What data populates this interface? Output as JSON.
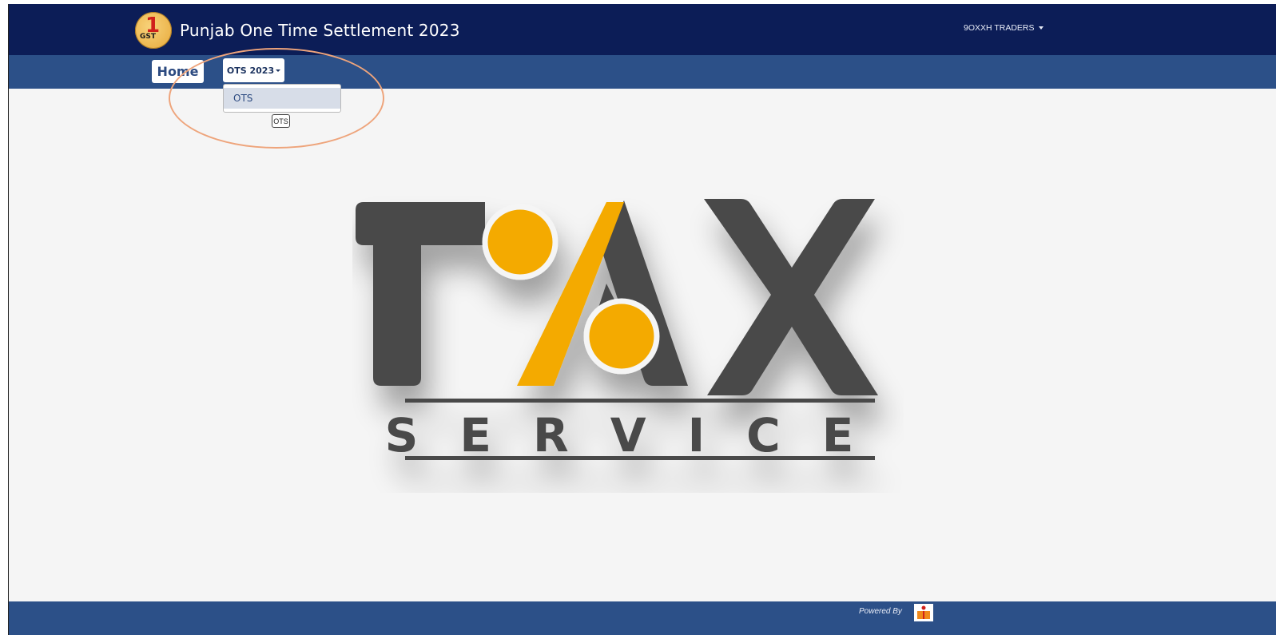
{
  "header": {
    "title": "Punjab One Time Settlement 2023",
    "logo_text_number": "1",
    "logo_text_sub": "GST",
    "user_name": "9OXXH TRADERS"
  },
  "nav": {
    "home_label": "Home",
    "ots_menu_label": "OTS 2023",
    "dropdown_items": [
      {
        "label": "OTS"
      }
    ],
    "ots_tag_label": "OTS"
  },
  "hero": {
    "word_top": "TAX",
    "word_bottom": "SERVICE",
    "letters_top": [
      "T",
      "A",
      "X"
    ],
    "letters_bottom": [
      "S",
      "E",
      "R",
      "V",
      "I",
      "C",
      "E"
    ],
    "colors": {
      "dark": "#4a4a4a",
      "accent": "#f4aa00"
    }
  },
  "footer": {
    "powered_by": "Powered By",
    "powered_logo_icon": "book-person-icon"
  },
  "colors": {
    "topbar": "#0c1d57",
    "navbar": "#2c5088",
    "page_bg": "#f5f5f5",
    "highlight": "#eea47b"
  }
}
